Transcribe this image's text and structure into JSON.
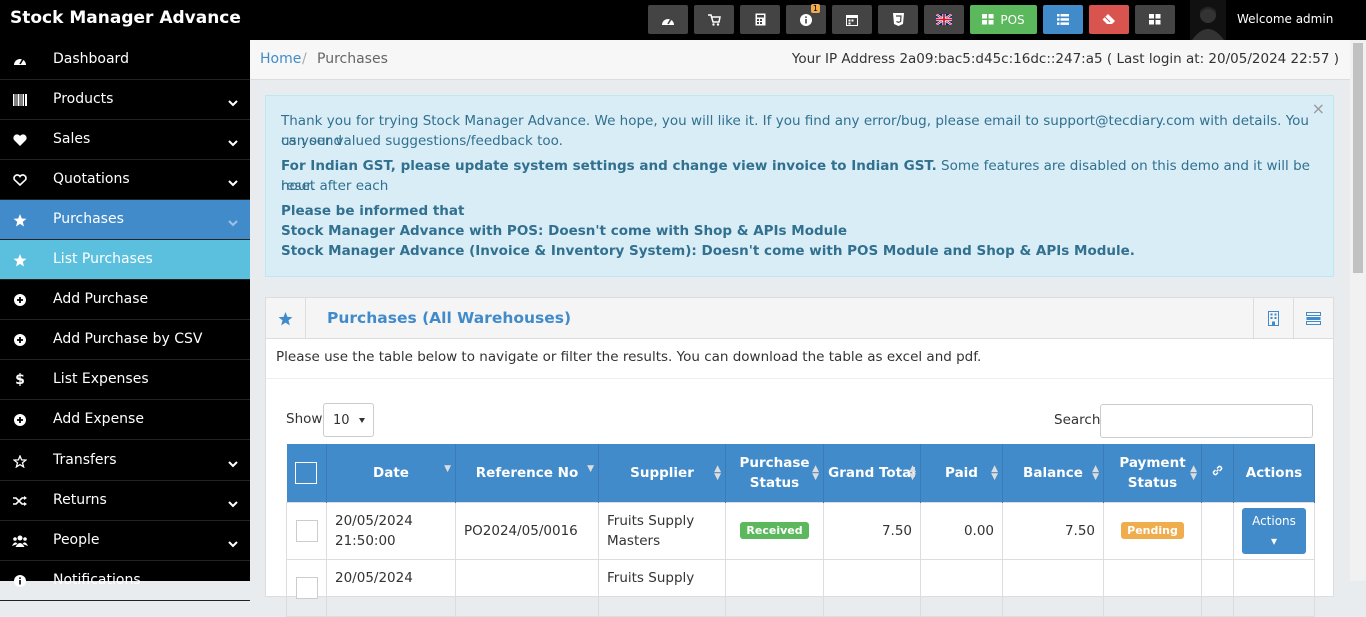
{
  "app": {
    "brand": "Stock Manager Advance",
    "welcome": "Welcome admin",
    "pos_label": "POS",
    "notification_count": "1"
  },
  "sidebar": {
    "items": [
      {
        "label": "Dashboard",
        "icon": "dashboard-icon"
      },
      {
        "label": "Products",
        "icon": "barcode-icon"
      },
      {
        "label": "Sales",
        "icon": "heart-icon"
      },
      {
        "label": "Quotations",
        "icon": "heart-outline-icon"
      },
      {
        "label": "Purchases",
        "icon": "star-icon"
      },
      {
        "label": "List Purchases",
        "icon": "star-icon"
      },
      {
        "label": "Add Purchase",
        "icon": "plus-circle-icon"
      },
      {
        "label": "Add Purchase by CSV",
        "icon": "plus-circle-icon"
      },
      {
        "label": "List Expenses",
        "icon": "dollar-icon"
      },
      {
        "label": "Add Expense",
        "icon": "plus-circle-icon"
      },
      {
        "label": "Transfers",
        "icon": "star-outline-icon"
      },
      {
        "label": "Returns",
        "icon": "random-icon"
      },
      {
        "label": "People",
        "icon": "users-icon"
      },
      {
        "label": "Notifications",
        "icon": "info-icon"
      }
    ]
  },
  "breadcrumb": {
    "home": "Home",
    "separator": "/",
    "current": "Purchases"
  },
  "ip_info": "Your IP Address 2a09:bac5:d45c:16dc::247:a5 ( Last login at: 20/05/2024 22:57 )",
  "alert": {
    "close": "×",
    "line1": "Thank you for trying Stock Manager Advance. We hope, you will like it. If you find any error/bug, please email to support@tecdiary.com with details. You can send",
    "line2": "us your valued suggestions/feedback too.",
    "gst_bold": "For Indian GST, please update system settings and change view invoice to Indian GST.",
    "gst_rest": " Some features are disabled on this demo and it will be reset after each",
    "gst_line2": "hour.",
    "info1": "Please be informed that",
    "info2": "Stock Manager Advance with POS: Doesn't come with Shop & APIs Module",
    "info3": "Stock Manager Advance (Invoice & Inventory System): Doesn't come with POS Module and Shop & APIs Module."
  },
  "panel": {
    "title": "Purchases (All Warehouses)",
    "intro": "Please use the table below to navigate or filter the results. You can download the table as excel and pdf.",
    "show_label": "Show",
    "show_value": "10",
    "search_label": "Search"
  },
  "table": {
    "headers": {
      "date": "Date",
      "ref": "Reference No",
      "supplier": "Supplier",
      "pstatus1": "Purchase",
      "pstatus2": "Status",
      "grand": "Grand Total",
      "paid": "Paid",
      "balance": "Balance",
      "paystatus1": "Payment",
      "paystatus2": "Status",
      "actions": "Actions"
    },
    "rows": [
      {
        "date1": "20/05/2024",
        "date2": "21:50:00",
        "ref": "PO2024/05/0016",
        "supplier1": "Fruits Supply",
        "supplier2": "Masters",
        "pstatus": "Received",
        "grand": "7.50",
        "paid": "0.00",
        "balance": "7.50",
        "paystatus": "Pending",
        "action": "Actions ▾"
      },
      {
        "date1": "20/05/2024",
        "date2": "",
        "ref": "",
        "supplier1": "Fruits Supply",
        "supplier2": "",
        "pstatus": "",
        "grand": "",
        "paid": "",
        "balance": "",
        "paystatus": "",
        "action": ""
      }
    ]
  },
  "colors": {
    "primary": "#428bca",
    "sidebar_bg": "#000000",
    "sub_active": "#5bc0de",
    "success": "#5cb85c",
    "warning": "#f0ad4e",
    "danger": "#d9534f"
  }
}
